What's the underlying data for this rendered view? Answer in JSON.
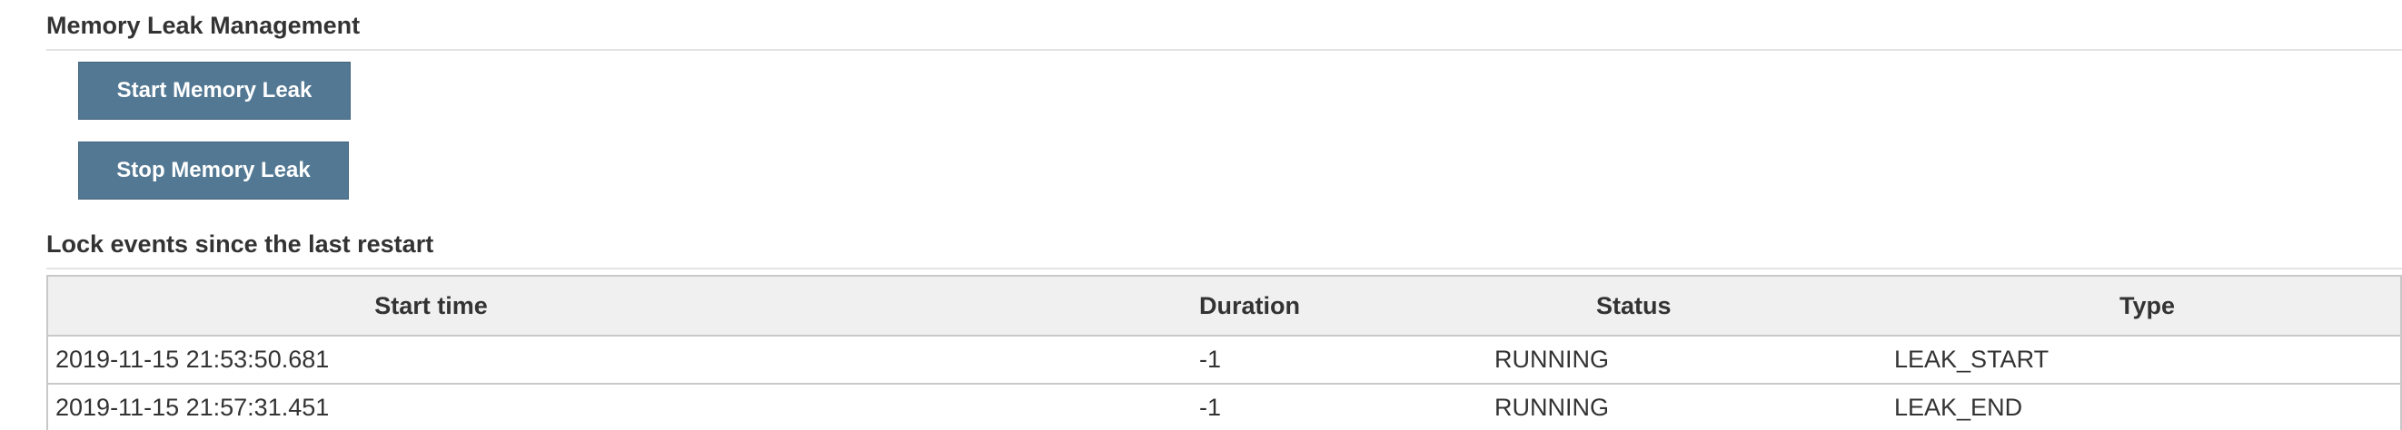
{
  "memory_section": {
    "title": "Memory Leak Management",
    "start_button": "Start Memory Leak",
    "stop_button": "Stop Memory Leak"
  },
  "lock_section": {
    "title": "Lock events since the last restart",
    "columns": {
      "start_time": "Start time",
      "duration": "Duration",
      "status": "Status",
      "type": "Type"
    },
    "rows": [
      {
        "start_time": "2019-11-15 21:53:50.681",
        "duration": "-1",
        "status": "RUNNING",
        "type": "LEAK_START"
      },
      {
        "start_time": "2019-11-15 21:57:31.451",
        "duration": "-1",
        "status": "RUNNING",
        "type": "LEAK_END"
      }
    ]
  },
  "colors": {
    "button_background": "#527893",
    "table_header_background": "#f0f0f0"
  }
}
